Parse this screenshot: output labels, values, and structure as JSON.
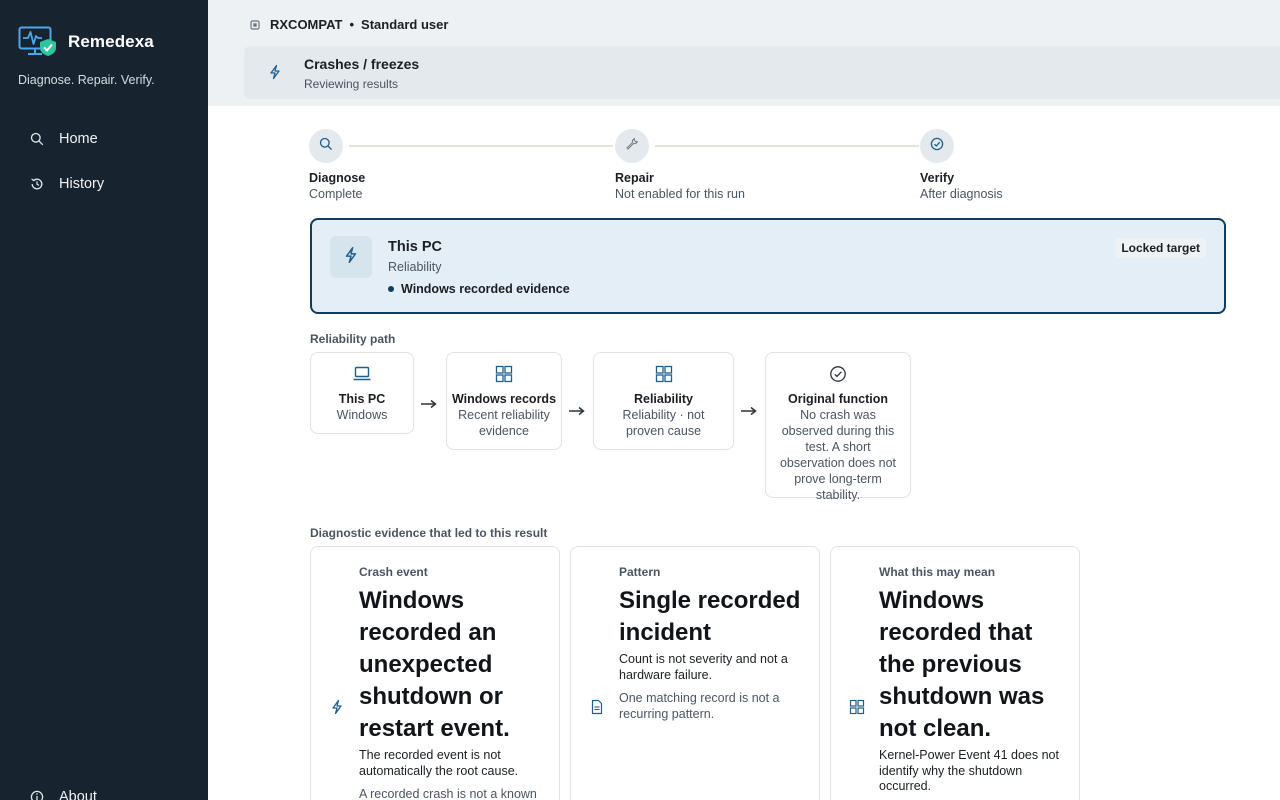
{
  "app": {
    "name": "Remedexa",
    "tagline": "Diagnose. Repair. Verify.",
    "accent_color": "#2ec4a0",
    "sidebar_color": "#17232e"
  },
  "sidebar": {
    "items": [
      {
        "label": "Home",
        "icon": "search-icon"
      },
      {
        "label": "History",
        "icon": "history-icon"
      },
      {
        "label": "About",
        "icon": "info-icon"
      }
    ]
  },
  "header": {
    "device": "RXCOMPAT",
    "separator": "•",
    "user_role": "Standard user",
    "task_title": "Crashes / freezes",
    "task_status": "Reviewing results"
  },
  "stepper": {
    "steps": [
      {
        "label": "Diagnose",
        "status": "Complete",
        "icon": "search-icon"
      },
      {
        "label": "Repair",
        "status": "Not enabled for this run",
        "icon": "wrench-icon"
      },
      {
        "label": "Verify",
        "status": "After diagnosis",
        "icon": "check-circle-icon"
      }
    ]
  },
  "target": {
    "title": "This PC",
    "subtitle": "Reliability",
    "evidence": "Windows recorded evidence",
    "badge": "Locked target"
  },
  "reliability_path": {
    "heading": "Reliability path",
    "nodes": [
      {
        "title": "This PC",
        "subtitle": "Windows",
        "icon": "laptop-icon"
      },
      {
        "title": "Windows records",
        "subtitle": "Recent reliability evidence",
        "icon": "windows-icon"
      },
      {
        "title": "Reliability",
        "subtitle": "Reliability · not proven cause",
        "icon": "windows-icon"
      },
      {
        "title": "Original function",
        "subtitle": "No crash was observed during this test. A short observation does not prove long-term stability.",
        "icon": "check-circle-icon"
      }
    ]
  },
  "evidence": {
    "heading": "Diagnostic evidence that led to this result",
    "cards": [
      {
        "label": "Crash event",
        "headline": "Windows recorded an unexpected shutdown or restart event.",
        "body": "The recorded event is not automatically the root cause.",
        "note": "A recorded crash is not a known",
        "icon": "bolt-icon"
      },
      {
        "label": "Pattern",
        "headline": "Single recorded incident",
        "body": "Count is not severity and not a hardware failure.",
        "note": "One matching record is not a recurring pattern.",
        "icon": "document-icon"
      },
      {
        "label": "What this may mean",
        "headline": "Windows recorded that the previous shutdown was not clean.",
        "body": "Kernel-Power Event 41 does not identify why the shutdown occurred.",
        "note": "",
        "icon": "windows-icon"
      }
    ]
  }
}
